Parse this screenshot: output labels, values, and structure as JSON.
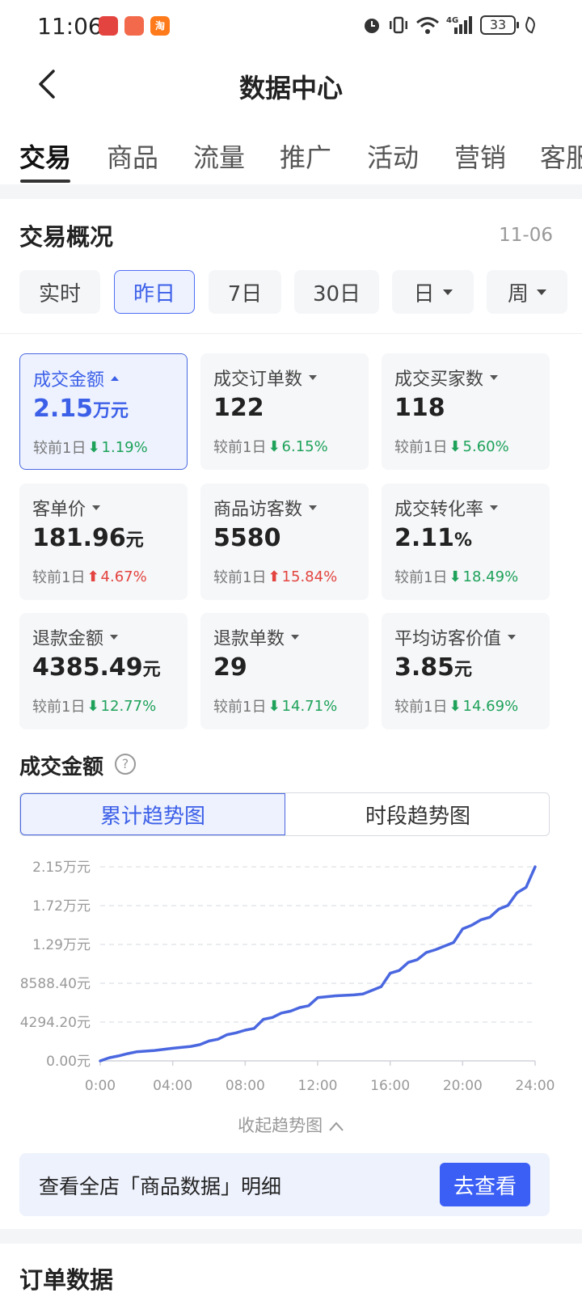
{
  "status_bar": {
    "time": "11:06",
    "battery": "33",
    "network": "4G",
    "app_icons": [
      {
        "icon": "app-icon-1",
        "color": "#e3443f"
      },
      {
        "icon": "app-icon-2",
        "color": "#f26a4b"
      },
      {
        "icon": "taobao-icon",
        "color": "#ff7a1a",
        "glyph": "淘"
      }
    ]
  },
  "nav": {
    "title": "数据中心"
  },
  "tabs": [
    "交易",
    "商品",
    "流量",
    "推广",
    "活动",
    "营销",
    "客服"
  ],
  "overview": {
    "title": "交易概况",
    "date": "11-06",
    "chips": [
      {
        "label": "实时",
        "active": false,
        "dropdown": false
      },
      {
        "label": "昨日",
        "active": true,
        "dropdown": false
      },
      {
        "label": "7日",
        "active": false,
        "dropdown": false
      },
      {
        "label": "30日",
        "active": false,
        "dropdown": false
      },
      {
        "label": "日",
        "active": false,
        "dropdown": true
      },
      {
        "label": "周",
        "active": false,
        "dropdown": true
      }
    ]
  },
  "metrics": [
    {
      "label": "成交金额",
      "value": "2.15",
      "unit": "万元",
      "compare_label": "较前1日",
      "direction": "down",
      "change": "1.19%",
      "active": true
    },
    {
      "label": "成交订单数",
      "value": "122",
      "unit": "",
      "compare_label": "较前1日",
      "direction": "down",
      "change": "6.15%",
      "active": false
    },
    {
      "label": "成交买家数",
      "value": "118",
      "unit": "",
      "compare_label": "较前1日",
      "direction": "down",
      "change": "5.60%",
      "active": false
    },
    {
      "label": "客单价",
      "value": "181.96",
      "unit": "元",
      "compare_label": "较前1日",
      "direction": "up",
      "change": "4.67%",
      "active": false
    },
    {
      "label": "商品访客数",
      "value": "5580",
      "unit": "",
      "compare_label": "较前1日",
      "direction": "up",
      "change": "15.84%",
      "active": false
    },
    {
      "label": "成交转化率",
      "value": "2.11",
      "unit": "%",
      "compare_label": "较前1日",
      "direction": "down",
      "change": "18.49%",
      "active": false
    },
    {
      "label": "退款金额",
      "value": "4385.49",
      "unit": "元",
      "compare_label": "较前1日",
      "direction": "down",
      "change": "12.77%",
      "active": false
    },
    {
      "label": "退款单数",
      "value": "29",
      "unit": "",
      "compare_label": "较前1日",
      "direction": "down",
      "change": "14.71%",
      "active": false
    },
    {
      "label": "平均访客价值",
      "value": "3.85",
      "unit": "元",
      "compare_label": "较前1日",
      "direction": "down",
      "change": "14.69%",
      "active": false
    }
  ],
  "chart_section": {
    "title": "成交金额",
    "help_icon": "question-circle-icon",
    "segments": [
      "累计趋势图",
      "时段趋势图"
    ],
    "active_segment": 0,
    "collapse_label": "收起趋势图"
  },
  "chart_data": {
    "type": "line",
    "y_tick_labels": [
      "0.00元",
      "4294.20元",
      "8588.40元",
      "1.29万元",
      "1.72万元",
      "2.15万元"
    ],
    "y_tick_values": [
      0,
      4294.2,
      8588.4,
      12882.6,
      17176.8,
      21471
    ],
    "ylim": [
      0,
      21471
    ],
    "x_tick_labels": [
      "0:00",
      "04:00",
      "08:00",
      "12:00",
      "16:00",
      "20:00",
      "24:00"
    ],
    "xlim": [
      0,
      24
    ],
    "grid": true,
    "line_color": "#4a67e0",
    "x": [
      0,
      0.5,
      1,
      1.5,
      2,
      3,
      4,
      4.5,
      5,
      5.5,
      6,
      6.5,
      7,
      7.5,
      8,
      8.5,
      9,
      9.5,
      10,
      10.5,
      11,
      11.5,
      12,
      13,
      14,
      14.5,
      15,
      15.5,
      16,
      16.5,
      17,
      17.5,
      18,
      18.5,
      19,
      19.5,
      20,
      20.5,
      21,
      21.5,
      22,
      22.5,
      23,
      23.5,
      24
    ],
    "y": [
      0,
      350,
      550,
      800,
      1000,
      1150,
      1400,
      1500,
      1600,
      1800,
      2200,
      2400,
      2900,
      3100,
      3400,
      3600,
      4600,
      4800,
      5300,
      5500,
      5900,
      6100,
      7000,
      7200,
      7300,
      7400,
      7800,
      8200,
      9700,
      10000,
      10900,
      11200,
      12000,
      12300,
      12700,
      13100,
      14600,
      15000,
      15600,
      15900,
      16800,
      17200,
      18600,
      19200,
      21471
    ]
  },
  "banner": {
    "text": "查看全店「商品数据」明细",
    "button": "去查看"
  },
  "next_section_title": "订单数据"
}
